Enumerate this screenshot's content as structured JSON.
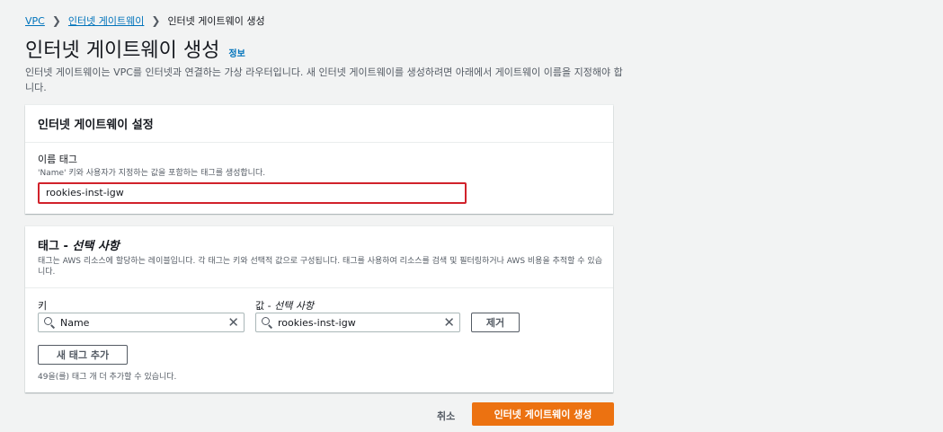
{
  "breadcrumb": {
    "items": [
      "VPC",
      "인터넷 게이트웨이",
      "인터넷 게이트웨이 생성"
    ]
  },
  "page": {
    "title": "인터넷 게이트웨이 생성",
    "info_link": "정보",
    "description": "인터넷 게이트웨이는 VPC를 인터넷과 연결하는 가상 라우터입니다. 새 인터넷 게이트웨이를 생성하려면 아래에서 게이트웨이 이름을 지정해야 합니다."
  },
  "settings_panel": {
    "title": "인터넷 게이트웨이 설정",
    "name_tag_label": "이름 태그",
    "name_tag_desc": "'Name' 키와 사용자가 지정하는 값을 포함하는 태그를 생성합니다.",
    "name_tag_value": "rookies-inst-igw"
  },
  "tags_panel": {
    "title_prefix": "태그 - ",
    "title_optional": "선택 사항",
    "description": "태그는 AWS 리소스에 할당하는 레이블입니다. 각 태그는 키와 선택적 값으로 구성됩니다. 태그를 사용하여 리소스를 검색 및 필터링하거나 AWS 비용을 추적할 수 있습니다.",
    "key_label": "키",
    "value_label_prefix": "값 - ",
    "value_label_optional": "선택 사항",
    "key_value": "Name",
    "value_value": "rookies-inst-igw",
    "remove_button": "제거",
    "add_tag_button": "새 태그 추가",
    "remaining_hint": "49을(를) 태그 개 더 추가할 수 있습니다."
  },
  "footer": {
    "cancel_label": "취소",
    "create_label": "인터넷 게이트웨이 생성"
  },
  "colors": {
    "primary": "#ec7211",
    "link": "#0073bb",
    "highlight_border": "#d1222b"
  }
}
